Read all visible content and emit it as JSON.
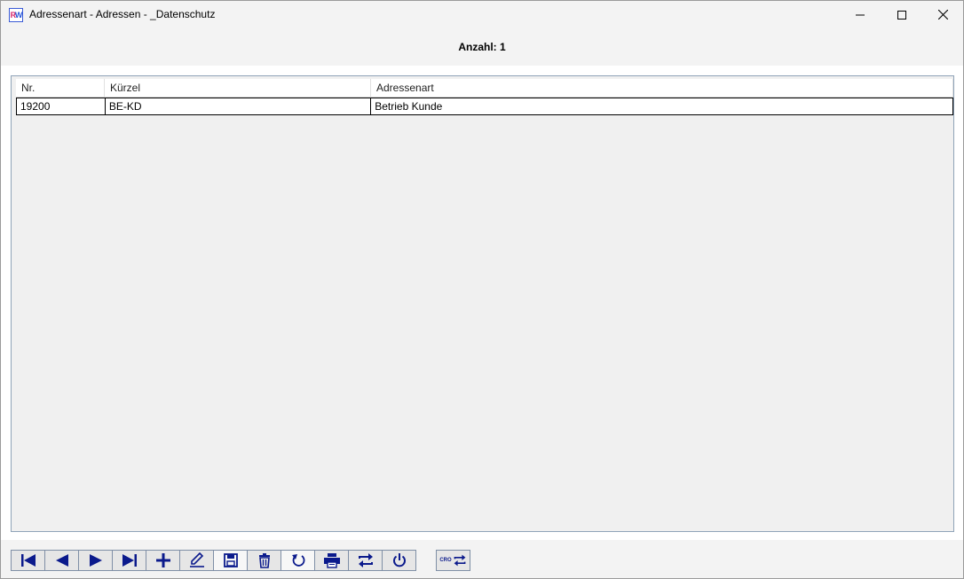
{
  "window": {
    "title": "Adressenart - Adressen - _Datenschutz",
    "icon": "rw-app-icon",
    "controls": [
      "minimize-icon",
      "maximize-icon",
      "close-icon"
    ]
  },
  "header": {
    "count_label": "Anzahl: 1"
  },
  "table": {
    "columns": [
      "Nr.",
      "Kürzel",
      "Adressenart"
    ],
    "rows": [
      [
        "19200",
        "BE-KD",
        "Betrieb Kunde"
      ]
    ]
  },
  "toolbar": {
    "buttons": [
      "first-record-icon",
      "previous-record-icon",
      "next-record-icon",
      "last-record-icon",
      "add-icon",
      "edit-icon",
      "save-icon",
      "delete-icon",
      "undo-icon",
      "print-icon",
      "swap-icon",
      "power-icon"
    ],
    "extra_button_label": "CRO",
    "accent_color": "#0b1a8c"
  }
}
